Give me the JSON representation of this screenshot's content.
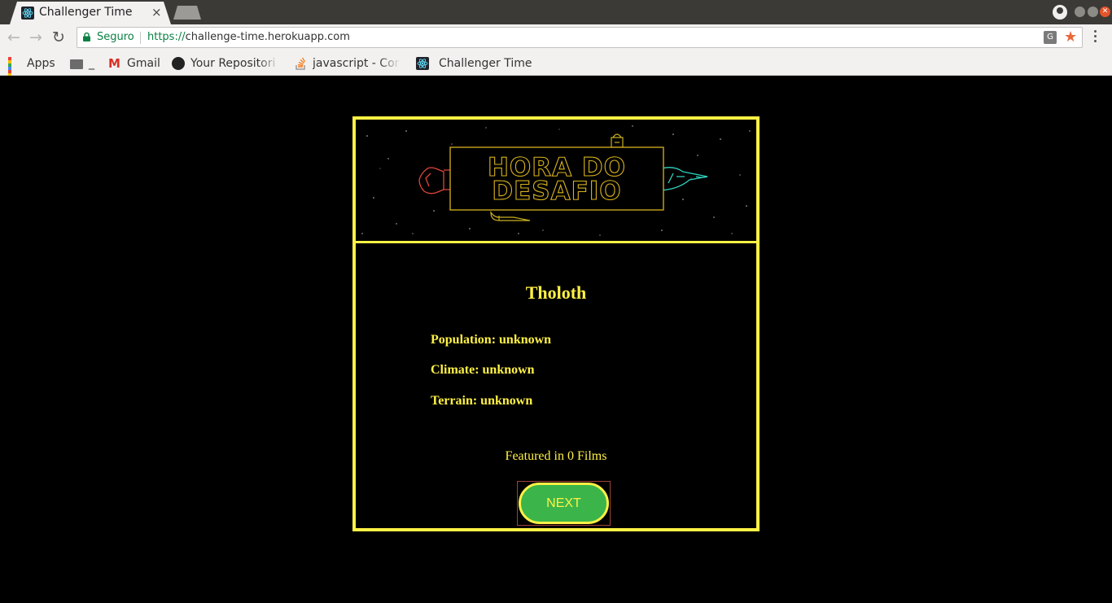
{
  "browser": {
    "tab_title": "Challenger Time",
    "tab_close": "×",
    "secure_label": "Seguro",
    "url_scheme": "https://",
    "url_host": "challenge-time.herokuapp.com",
    "bookmarks": [
      {
        "label": "Apps",
        "icon": "apps-grid-icon"
      },
      {
        "label": "_",
        "icon": "folder-icon"
      },
      {
        "label": "Gmail",
        "icon": "gmail-icon"
      },
      {
        "label": "Your Repositori",
        "icon": "github-icon"
      },
      {
        "label": "javascript - Corr",
        "icon": "stackoverflow-icon"
      },
      {
        "label": "Challenger Time",
        "icon": "react-icon"
      }
    ]
  },
  "banner": {
    "line1": "HORA DO",
    "line2": "DESAFIO"
  },
  "planet": {
    "name": "Tholoth",
    "population": "Population: unknown",
    "climate": "Climate: unknown",
    "terrain": "Terrain: unknown",
    "films": "Featured in 0 Films"
  },
  "actions": {
    "next_label": "NEXT"
  },
  "colors": {
    "accent": "#fff145",
    "button": "#3bb54a",
    "background": "#000000"
  }
}
